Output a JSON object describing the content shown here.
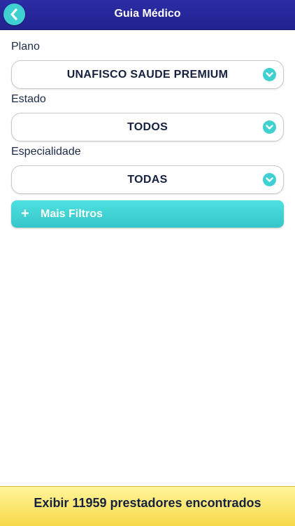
{
  "header": {
    "title": "Guia Médico",
    "back_icon": "chevron-left-icon"
  },
  "form": {
    "plano": {
      "label": "Plano",
      "value": "UNAFISCO SAUDE PREMIUM"
    },
    "estado": {
      "label": "Estado",
      "value": "TODOS"
    },
    "especialidade": {
      "label": "Especialidade",
      "value": "TODAS"
    },
    "dropdown_icon": "chevron-down-circle-icon"
  },
  "more_filters": {
    "icon": "+",
    "label": "Mais Filtros"
  },
  "footer": {
    "label": "Exibir 11959 prestadores encontrados"
  },
  "colors": {
    "header": "#2525a0",
    "accent": "#3fd0d2",
    "footer": "#fbe46a",
    "text": "#16213f"
  }
}
